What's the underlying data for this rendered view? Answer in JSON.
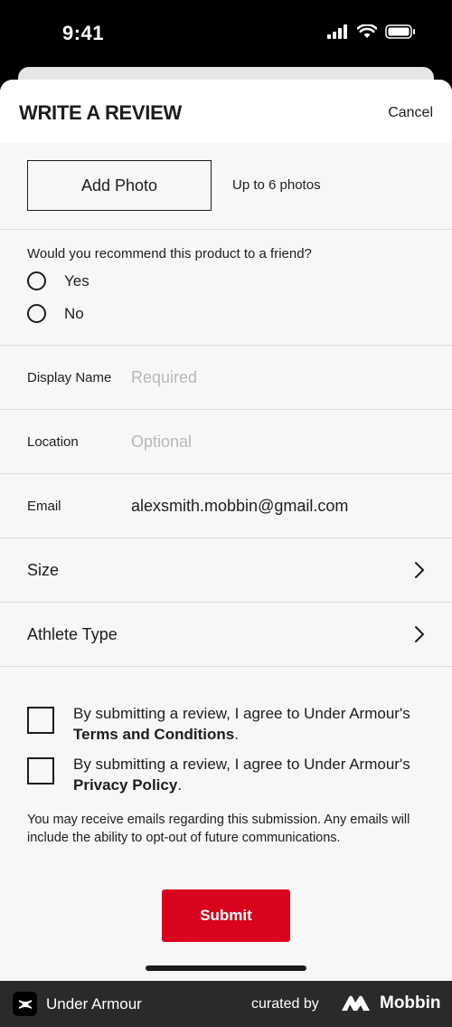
{
  "status_bar": {
    "time": "9:41"
  },
  "header": {
    "title": "WRITE A REVIEW",
    "cancel_label": "Cancel"
  },
  "photo": {
    "button_label": "Add Photo",
    "hint": "Up to 6 photos"
  },
  "recommend": {
    "question": "Would you recommend this product to a friend?",
    "options": [
      "Yes",
      "No"
    ]
  },
  "fields": {
    "display_name": {
      "label": "Display Name",
      "placeholder": "Required",
      "value": ""
    },
    "location": {
      "label": "Location",
      "placeholder": "Optional",
      "value": ""
    },
    "email": {
      "label": "Email",
      "value": "alexsmith.mobbin@gmail.com"
    }
  },
  "selects": {
    "size": "Size",
    "athlete_type": "Athlete Type"
  },
  "agreements": {
    "terms_prefix": "By submitting a review, I agree to Under Armour's",
    "terms_link": "Terms and Conditions",
    "privacy_prefix": "By submitting a review, I agree to Under Armour's",
    "privacy_link": "Privacy Policy",
    "suffix": "."
  },
  "disclaimer": "You may receive emails regarding this submission. Any emails will include the ability to opt-out of future communications.",
  "submit_label": "Submit",
  "footer": {
    "app_name": "Under Armour",
    "curated_by": "curated by",
    "brand": "Mobbin"
  },
  "colors": {
    "accent": "#d9041c",
    "background": "#f7f7f7",
    "text": "#1d1d1d",
    "placeholder": "#b8b8b8"
  }
}
